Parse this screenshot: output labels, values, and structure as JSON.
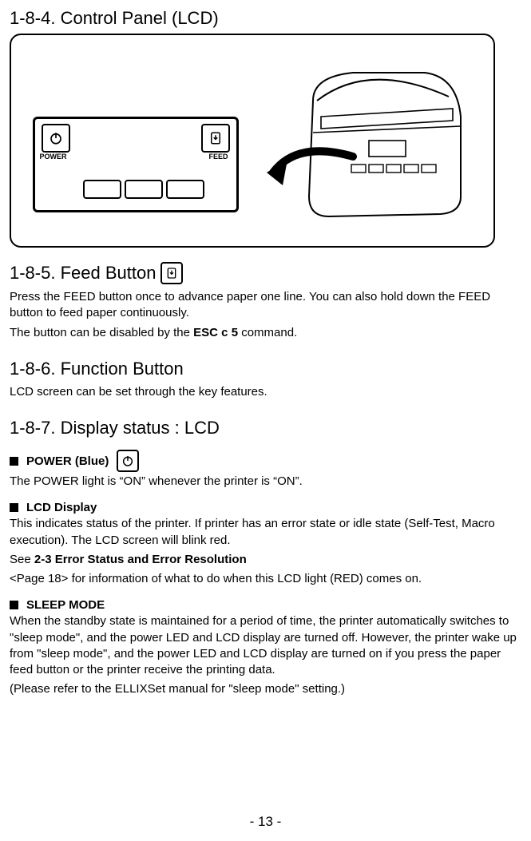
{
  "section184": {
    "heading": "1-8-4. Control Panel (LCD)",
    "panel": {
      "power_label": "POWER",
      "feed_label": "FEED"
    }
  },
  "section185": {
    "heading": "1-8-5. Feed Button",
    "p1a": "Press the FEED button once to advance paper one line. You can also hold down the FEED button to feed paper continuously.",
    "p2a": "The button can be disabled by the ",
    "p2b": "ESC c 5",
    "p2c": " command."
  },
  "section186": {
    "heading": "1-8-6. Function Button",
    "p1": "LCD screen can be set through the key features."
  },
  "section187": {
    "heading": "1-8-7. Display status : LCD",
    "power": {
      "title": "POWER (Blue)",
      "text": "The POWER light is “ON” whenever the printer is “ON”."
    },
    "lcd": {
      "title": "LCD Display",
      "p1": "This indicates status of the printer. If printer has an error state or idle state (Self-Test, Macro execution). The LCD screen will blink red.",
      "p2a": "See ",
      "p2b": "2-3 Error Status and Error Resolution",
      "p3": "<Page 18> for information of what to do when this LCD light (RED) comes on."
    },
    "sleep": {
      "title": "SLEEP MODE",
      "p1": "When the standby state is maintained for a period of time, the printer automatically switches to \"sleep mode\", and the power LED and LCD display are turned off. However, the printer wake up from \"sleep mode\", and the power LED and LCD display are turned on if you press the paper feed button or the printer receive the printing data.",
      "p2": "(Please refer to the ELLIXSet manual for \"sleep mode\" setting.)"
    }
  },
  "page_number": "- 13 -"
}
